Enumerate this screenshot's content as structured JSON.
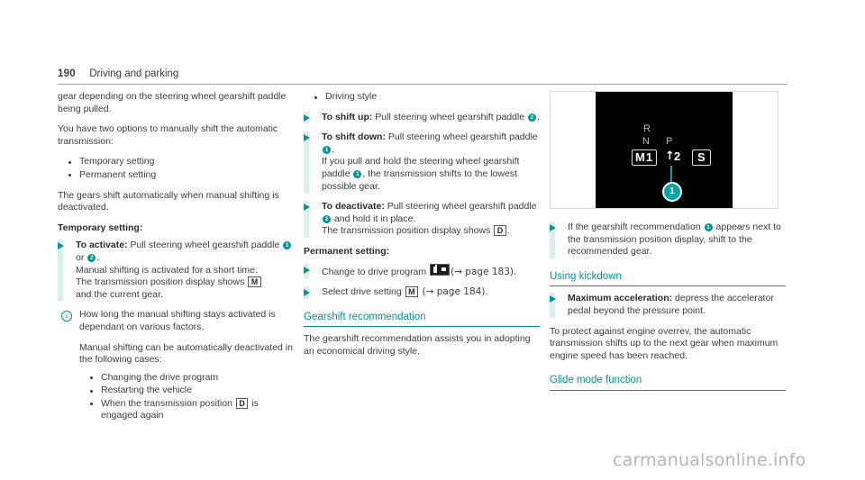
{
  "header": {
    "page_number": "190",
    "chapter": "Driving and parking"
  },
  "colors": {
    "accent_teal": "#009597",
    "accent_teal_light": "#d9f0ef",
    "display_teal": "#00a6a8",
    "body_text": "#3c3c3c"
  },
  "column1": {
    "para1": "gear depending on the steering wheel gearshift paddle being pulled.",
    "para2": "You have two options to manually shift the automatic transmission:",
    "options": [
      "Temporary setting",
      "Permanent setting"
    ],
    "para3": "The gears shift automatically when manual shifting is deactivated.",
    "subhead": "Temporary setting:",
    "step_activate": {
      "bold_lead": "To activate:",
      "text_before_badge1": " Pull steering wheel gearshift paddle ",
      "badge1": "1",
      "between_badges": " or ",
      "badge2": "2",
      "after_badges": ".",
      "line2": "Manual shifting is activated for a short time.",
      "line3_before_symbol": "The transmission position display shows ",
      "symbol": "M",
      "line4": "and the current gear."
    },
    "note": {
      "icon": "info-icon",
      "text1": "How long the manual shifting stays activated is dependant on various factors.",
      "text2": "Manual shifting can be automatically deactivated in the following cases:",
      "cases_prefix": "When the transmission position ",
      "cases_symbol": "D",
      "cases_suffix": " is engaged again",
      "cases": [
        "Changing the drive program",
        "Restarting the vehicle"
      ]
    }
  },
  "column2": {
    "bullet_driving_style": "Driving style",
    "step_shift_up": {
      "bold_lead": "To shift up:",
      "text": " Pull steering wheel gearshift paddle ",
      "badge": "2",
      "after": "."
    },
    "step_shift_down": {
      "bold_lead": "To shift down:",
      "text": " Pull steering wheel gearshift paddle ",
      "badge": "1",
      "after": ".",
      "line2_pre": "If you pull and hold the steering wheel gearshift paddle ",
      "line2_badge": "1",
      "line2_post": ", the transmission shifts to the lowest possible gear."
    },
    "step_deactivate": {
      "bold_lead": "To deactivate:",
      "text": " Pull steering wheel gearshift paddle ",
      "badge": "2",
      "after": " and hold it in place.",
      "line2_pre": "The transmission position display shows ",
      "line2_symbol": "D",
      "line2_post": "."
    },
    "subhead": "Permanent setting:",
    "step_change_program": {
      "text": "Change to drive program ",
      "icon": "drive-program-icon",
      "ref": "(→ page 183)."
    },
    "step_drive_setting": {
      "text": "Select drive setting ",
      "symbol": "M",
      "ref": " (→ page 184)."
    },
    "section_heading": "Gearshift recommendation",
    "section_para": "The gearshift recommendation assists you in adopting an economical driving style."
  },
  "column3": {
    "figure": {
      "name": "transmission-position-display",
      "label_r": "R",
      "label_n": "N",
      "label_p": "P",
      "gear_box": "M1",
      "up_arrow": "↑",
      "next_gear": "2",
      "mode_box": "S",
      "callout": "1"
    },
    "step_recommendation": {
      "text_pre": "If the gearshift recommendation ",
      "badge": "1",
      "text_post": " appears next to the transmission position display, shift to the recommended gear."
    },
    "kickdown_heading": "Using kickdown",
    "step_kickdown": {
      "bold_lead": "Maximum acceleration:",
      "text": " depress the accelerator pedal beyond the pressure point."
    },
    "kickdown_para": "To protect against engine overrev, the automatic transmission shifts up to the next gear when maximum engine speed has been reached.",
    "glide_heading": "Glide mode function"
  },
  "watermark": "carmanualsonline.info"
}
